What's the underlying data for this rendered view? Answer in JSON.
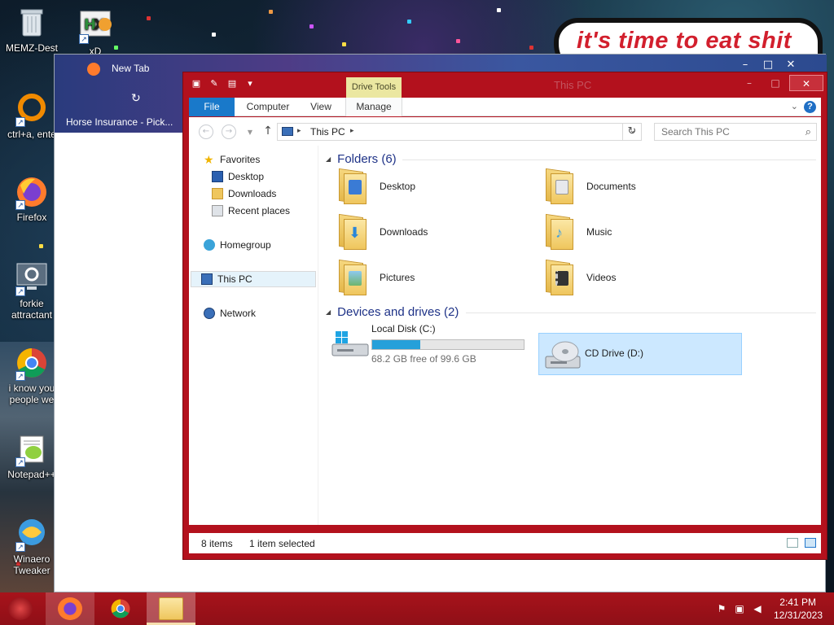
{
  "desktop": {
    "meme_text": "it's time to eat shit",
    "icons": [
      {
        "label": "MEMZ-Dest",
        "icon": "recycle-bin-icon"
      },
      {
        "label": "xD",
        "icon": "hxd-icon"
      },
      {
        "label": "ctrl+a, ente",
        "icon": "ring-icon"
      },
      {
        "label": "Firefox",
        "icon": "firefox-icon"
      },
      {
        "label": "forkie attractant",
        "icon": "settings-monitor-icon"
      },
      {
        "label": "i know you people we",
        "icon": "chrome-icon"
      },
      {
        "label": "Notepad++",
        "icon": "notepadpp-icon"
      },
      {
        "label": "Winaero Tweaker",
        "icon": "winaero-icon"
      }
    ]
  },
  "browser": {
    "tab_title": "New Tab",
    "bookmark": "Horse Insurance - Pick..."
  },
  "explorer": {
    "title": "This PC",
    "contextual_tab": "Drive Tools",
    "ribbon_tabs": {
      "file": "File",
      "computer": "Computer",
      "view": "View",
      "manage": "Manage"
    },
    "address": {
      "path": "This PC",
      "search_placeholder": "Search This PC"
    },
    "nav_pane": {
      "favorites": "Favorites",
      "desktop": "Desktop",
      "downloads": "Downloads",
      "recent": "Recent places",
      "homegroup": "Homegroup",
      "this_pc": "This PC",
      "network": "Network"
    },
    "folders_header": "Folders (6)",
    "folders": [
      {
        "label": "Desktop",
        "emblem": "#3a7bd5"
      },
      {
        "label": "Documents",
        "emblem": "#c8c8d0"
      },
      {
        "label": "Downloads",
        "emblem": "#2a86d8"
      },
      {
        "label": "Music",
        "emblem": "#3fa0e0"
      },
      {
        "label": "Pictures",
        "emblem": "#6db56d"
      },
      {
        "label": "Videos",
        "emblem": "#444"
      }
    ],
    "devices_header": "Devices and drives (2)",
    "drives": [
      {
        "name": "Local Disk (C:)",
        "free": "68.2 GB free of 99.6 GB",
        "used_fraction": 0.315
      },
      {
        "name": "CD Drive (D:)"
      }
    ],
    "status": {
      "items": "8 items",
      "selected": "1 item selected"
    }
  },
  "taskbar": {
    "time": "2:41 PM",
    "date": "12/31/2023"
  },
  "colors": {
    "accent": "#b3111d",
    "file_tab": "#1979ca",
    "header_text": "#1e3287",
    "selection": "#cce8ff"
  }
}
